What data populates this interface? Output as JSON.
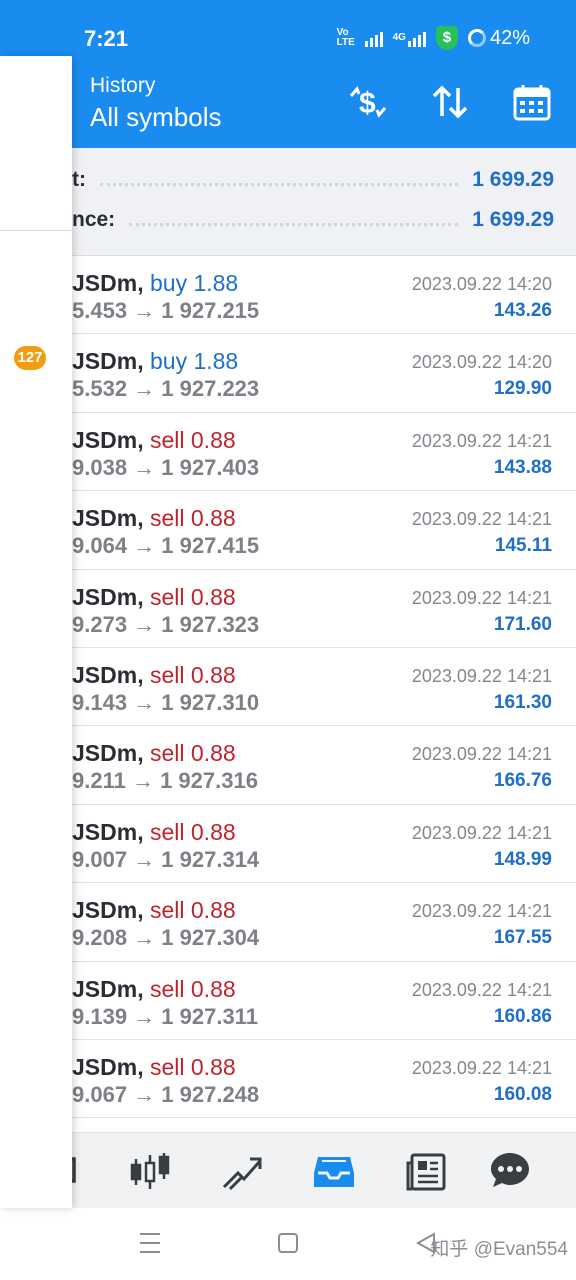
{
  "status_bar": {
    "time": "7:21",
    "volte_label": "Vo LTE",
    "net_label": "4G",
    "security_symbol": "$",
    "battery": "42%"
  },
  "header": {
    "subtitle": "History",
    "title": "All symbols",
    "actions": [
      "deposit-withdraw-icon",
      "sort-icon",
      "calendar-icon"
    ]
  },
  "summary": {
    "rows": [
      {
        "label": "t:",
        "value": "1 699.29"
      },
      {
        "label": "nce:",
        "value": "1 699.29"
      }
    ]
  },
  "deals": [
    {
      "symbol": "JSDm,",
      "side": "buy",
      "side_label": "buy 1.88",
      "prices": "5.453 → 1 927.215",
      "time": "2023.09.22 14:20",
      "profit": "143.26"
    },
    {
      "symbol": "JSDm,",
      "side": "buy",
      "side_label": "buy 1.88",
      "prices": "5.532 → 1 927.223",
      "time": "2023.09.22 14:20",
      "profit": "129.90"
    },
    {
      "symbol": "JSDm,",
      "side": "sell",
      "side_label": "sell 0.88",
      "prices": "9.038 → 1 927.403",
      "time": "2023.09.22 14:21",
      "profit": "143.88"
    },
    {
      "symbol": "JSDm,",
      "side": "sell",
      "side_label": "sell 0.88",
      "prices": "9.064 → 1 927.415",
      "time": "2023.09.22 14:21",
      "profit": "145.11"
    },
    {
      "symbol": "JSDm,",
      "side": "sell",
      "side_label": "sell 0.88",
      "prices": "9.273 → 1 927.323",
      "time": "2023.09.22 14:21",
      "profit": "171.60"
    },
    {
      "symbol": "JSDm,",
      "side": "sell",
      "side_label": "sell 0.88",
      "prices": "9.143 → 1 927.310",
      "time": "2023.09.22 14:21",
      "profit": "161.30"
    },
    {
      "symbol": "JSDm,",
      "side": "sell",
      "side_label": "sell 0.88",
      "prices": "9.211 → 1 927.316",
      "time": "2023.09.22 14:21",
      "profit": "166.76"
    },
    {
      "symbol": "JSDm,",
      "side": "sell",
      "side_label": "sell 0.88",
      "prices": "9.007 → 1 927.314",
      "time": "2023.09.22 14:21",
      "profit": "148.99"
    },
    {
      "symbol": "JSDm,",
      "side": "sell",
      "side_label": "sell 0.88",
      "prices": "9.208 → 1 927.304",
      "time": "2023.09.22 14:21",
      "profit": "167.55"
    },
    {
      "symbol": "JSDm,",
      "side": "sell",
      "side_label": "sell 0.88",
      "prices": "9.139 → 1 927.311",
      "time": "2023.09.22 14:21",
      "profit": "160.86"
    },
    {
      "symbol": "JSDm,",
      "side": "sell",
      "side_label": "sell 0.88",
      "prices": "9.067 → 1 927.248",
      "time": "2023.09.22 14:21",
      "profit": "160.08"
    }
  ],
  "bottom_nav": {
    "items": [
      "quotes-icon",
      "chart-icon",
      "trade-icon",
      "history-icon",
      "news-icon",
      "messages-icon"
    ],
    "active": "history-icon"
  },
  "drawer": {
    "badge": "127"
  },
  "watermark": "知乎 @Evan554",
  "colors": {
    "accent": "#1a8cf0",
    "buy": "#1f6fc9",
    "sell": "#c0242a",
    "profit": "#1f6fc9",
    "badge": "#f39c12"
  }
}
